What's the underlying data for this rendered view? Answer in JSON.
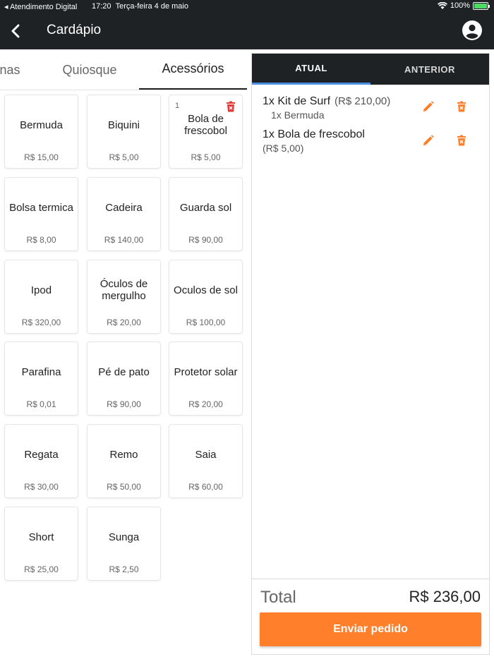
{
  "status_bar": {
    "carrier": "◂ Atendimento Digital",
    "time": "17:20",
    "date": "Terça-feira 4 de maio",
    "battery": "100%"
  },
  "header": {
    "title": "Cardápio",
    "back_icon": "chevron-left-icon",
    "account_icon": "account-circle-icon"
  },
  "category_tabs": [
    {
      "label": "nas"
    },
    {
      "label": "Quiosque"
    },
    {
      "label": "Acessórios",
      "active": true
    }
  ],
  "products": [
    {
      "name": "Bermuda",
      "price": "R$ 15,00"
    },
    {
      "name": "Biquini",
      "price": "R$ 5,00"
    },
    {
      "name": "Bola de frescobol",
      "price": "R$ 5,00",
      "qty": "1"
    },
    {
      "name": "Bolsa termica",
      "price": "R$ 8,00"
    },
    {
      "name": "Cadeira",
      "price": "R$ 140,00"
    },
    {
      "name": "Guarda sol",
      "price": "R$ 90,00"
    },
    {
      "name": "Ipod",
      "price": "R$ 320,00"
    },
    {
      "name": "Óculos de mergulho",
      "price": "R$ 20,00"
    },
    {
      "name": "Oculos de sol",
      "price": "R$ 100,00"
    },
    {
      "name": "Parafina",
      "price": "R$ 0,01"
    },
    {
      "name": "Pé de pato",
      "price": "R$ 90,00"
    },
    {
      "name": "Protetor solar",
      "price": "R$ 20,00"
    },
    {
      "name": "Regata",
      "price": "R$ 30,00"
    },
    {
      "name": "Remo",
      "price": "R$ 50,00"
    },
    {
      "name": "Saia",
      "price": "R$ 60,00"
    },
    {
      "name": "Short",
      "price": "R$ 25,00"
    },
    {
      "name": "Sunga",
      "price": "R$ 2,50"
    }
  ],
  "order": {
    "tabs": [
      {
        "label": "ATUAL",
        "active": true
      },
      {
        "label": "ANTERIOR"
      }
    ],
    "items": [
      {
        "label": "1x Kit de Surf",
        "price": "(R$ 210,00)",
        "sub": "1x Bermuda"
      },
      {
        "label": "1x Bola de frescobol",
        "price": "(R$ 5,00)"
      }
    ],
    "total_label": "Total",
    "total_value": "R$ 236,00",
    "send_label": "Enviar pedido"
  },
  "colors": {
    "dark_bar": "#1f2224",
    "accent_orange": "#ff7f2a",
    "delete_red": "#e53935",
    "tab_indicator": "#4a90e2"
  }
}
